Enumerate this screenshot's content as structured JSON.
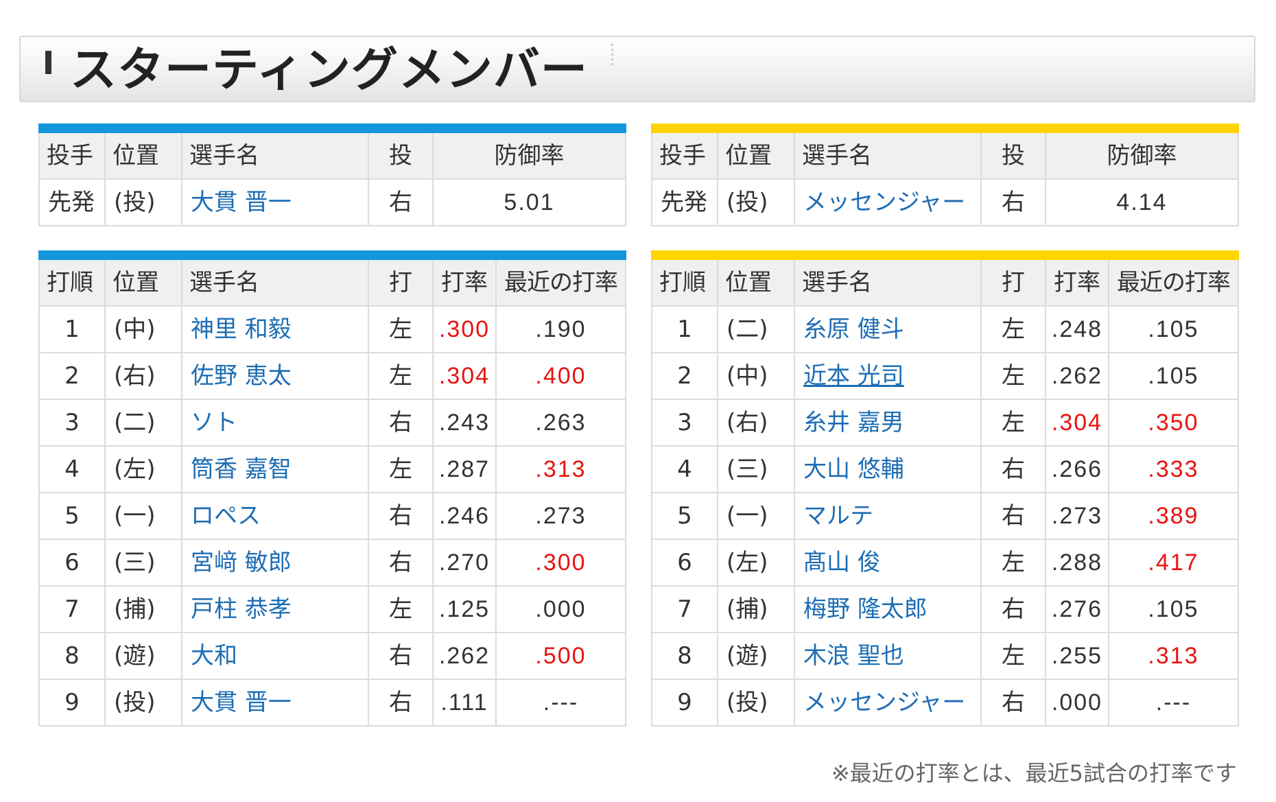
{
  "title": "スターティングメンバー",
  "pitcher_headers": [
    "投手",
    "位置",
    "選手名",
    "投",
    "防御率"
  ],
  "batter_headers": [
    "打順",
    "位置",
    "選手名",
    "打",
    "打率",
    "最近の打率"
  ],
  "teams": [
    {
      "accent_color": "#1297dd",
      "pitcher": {
        "role": "先発",
        "pos": "(投)",
        "name": "大貫 晋一",
        "throws": "右",
        "era": "5.01"
      },
      "batters": [
        {
          "order": "1",
          "pos": "(中)",
          "name": "神里 和毅",
          "bats": "左",
          "avg": ".300",
          "recent": ".190",
          "avg_hot": true,
          "recent_hot": false
        },
        {
          "order": "2",
          "pos": "(右)",
          "name": "佐野 恵太",
          "bats": "左",
          "avg": ".304",
          "recent": ".400",
          "avg_hot": true,
          "recent_hot": true
        },
        {
          "order": "3",
          "pos": "(二)",
          "name": "ソト",
          "bats": "右",
          "avg": ".243",
          "recent": ".263",
          "avg_hot": false,
          "recent_hot": false
        },
        {
          "order": "4",
          "pos": "(左)",
          "name": "筒香 嘉智",
          "bats": "左",
          "avg": ".287",
          "recent": ".313",
          "avg_hot": false,
          "recent_hot": true
        },
        {
          "order": "5",
          "pos": "(一)",
          "name": "ロペス",
          "bats": "右",
          "avg": ".246",
          "recent": ".273",
          "avg_hot": false,
          "recent_hot": false
        },
        {
          "order": "6",
          "pos": "(三)",
          "name": "宮﨑 敏郎",
          "bats": "右",
          "avg": ".270",
          "recent": ".300",
          "avg_hot": false,
          "recent_hot": true
        },
        {
          "order": "7",
          "pos": "(捕)",
          "name": "戸柱 恭孝",
          "bats": "左",
          "avg": ".125",
          "recent": ".000",
          "avg_hot": false,
          "recent_hot": false
        },
        {
          "order": "8",
          "pos": "(遊)",
          "name": "大和",
          "bats": "右",
          "avg": ".262",
          "recent": ".500",
          "avg_hot": false,
          "recent_hot": true
        },
        {
          "order": "9",
          "pos": "(投)",
          "name": "大貫 晋一",
          "bats": "右",
          "avg": ".111",
          "recent": ".---",
          "avg_hot": false,
          "recent_hot": false
        }
      ]
    },
    {
      "accent_color": "#ffd400",
      "pitcher": {
        "role": "先発",
        "pos": "(投)",
        "name": "メッセンジャー",
        "throws": "右",
        "era": "4.14"
      },
      "batters": [
        {
          "order": "1",
          "pos": "(二)",
          "name": "糸原 健斗",
          "bats": "左",
          "avg": ".248",
          "recent": ".105",
          "avg_hot": false,
          "recent_hot": false
        },
        {
          "order": "2",
          "pos": "(中)",
          "name": "近本 光司",
          "bats": "左",
          "avg": ".262",
          "recent": ".105",
          "avg_hot": false,
          "recent_hot": false,
          "underline": true
        },
        {
          "order": "3",
          "pos": "(右)",
          "name": "糸井 嘉男",
          "bats": "左",
          "avg": ".304",
          "recent": ".350",
          "avg_hot": true,
          "recent_hot": true
        },
        {
          "order": "4",
          "pos": "(三)",
          "name": "大山 悠輔",
          "bats": "右",
          "avg": ".266",
          "recent": ".333",
          "avg_hot": false,
          "recent_hot": true
        },
        {
          "order": "5",
          "pos": "(一)",
          "name": "マルテ",
          "bats": "右",
          "avg": ".273",
          "recent": ".389",
          "avg_hot": false,
          "recent_hot": true
        },
        {
          "order": "6",
          "pos": "(左)",
          "name": "髙山 俊",
          "bats": "左",
          "avg": ".288",
          "recent": ".417",
          "avg_hot": false,
          "recent_hot": true
        },
        {
          "order": "7",
          "pos": "(捕)",
          "name": "梅野 隆太郎",
          "bats": "右",
          "avg": ".276",
          "recent": ".105",
          "avg_hot": false,
          "recent_hot": false
        },
        {
          "order": "8",
          "pos": "(遊)",
          "name": "木浪 聖也",
          "bats": "左",
          "avg": ".255",
          "recent": ".313",
          "avg_hot": false,
          "recent_hot": true
        },
        {
          "order": "9",
          "pos": "(投)",
          "name": "メッセンジャー",
          "bats": "右",
          "avg": ".000",
          "recent": ".---",
          "avg_hot": false,
          "recent_hot": false
        }
      ]
    }
  ],
  "footnote": "※最近の打率とは、最近5試合の打率です"
}
